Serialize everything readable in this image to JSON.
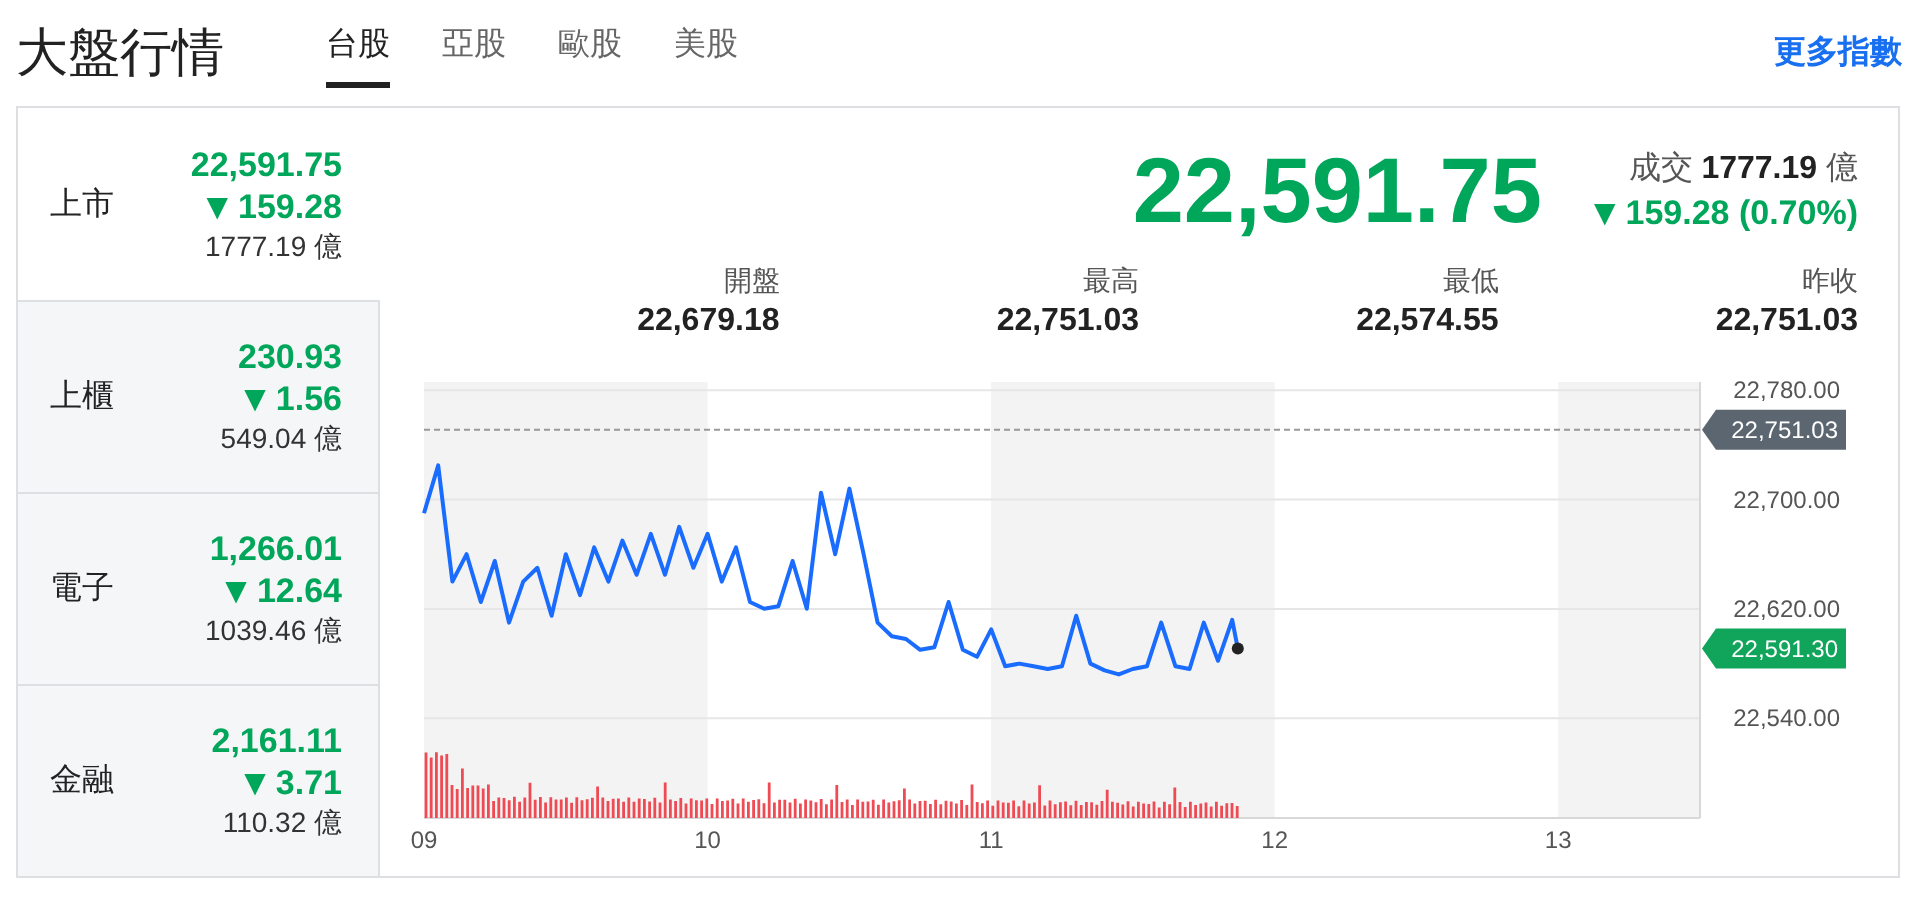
{
  "title": "大盤行情",
  "tabs": [
    {
      "label": "台股",
      "selected": true
    },
    {
      "label": "亞股",
      "selected": false
    },
    {
      "label": "歐股",
      "selected": false
    },
    {
      "label": "美股",
      "selected": false
    }
  ],
  "more_link": "更多指數",
  "indices": [
    {
      "name": "上市",
      "price": "22,591.75",
      "change": "159.28",
      "arrow": "▼",
      "volume": "1777.19",
      "unit": "億",
      "selected": true
    },
    {
      "name": "上櫃",
      "price": "230.93",
      "change": "1.56",
      "arrow": "▼",
      "volume": "549.04",
      "unit": "億",
      "selected": false
    },
    {
      "name": "電子",
      "price": "1,266.01",
      "change": "12.64",
      "arrow": "▼",
      "volume": "1039.46",
      "unit": "億",
      "selected": false
    },
    {
      "name": "金融",
      "price": "2,161.11",
      "change": "3.71",
      "arrow": "▼",
      "volume": "110.32",
      "unit": "億",
      "selected": false
    }
  ],
  "quote": {
    "price": "22,591.75",
    "volume_label": "成交",
    "volume": "1777.19",
    "unit": "億",
    "change": "159.28 (0.70%)",
    "arrow": "▼"
  },
  "stats": [
    {
      "label": "開盤",
      "value": "22,679.18"
    },
    {
      "label": "最高",
      "value": "22,751.03"
    },
    {
      "label": "最低",
      "value": "22,574.55"
    },
    {
      "label": "昨收",
      "value": "22,751.03"
    }
  ],
  "chart_data": {
    "type": "line",
    "x": [
      9.0,
      9.05,
      9.1,
      9.15,
      9.2,
      9.25,
      9.3,
      9.35,
      9.4,
      9.45,
      9.5,
      9.55,
      9.6,
      9.65,
      9.7,
      9.75,
      9.8,
      9.85,
      9.9,
      9.95,
      10.0,
      10.05,
      10.1,
      10.15,
      10.2,
      10.25,
      10.3,
      10.35,
      10.4,
      10.45,
      10.5,
      10.55,
      10.6,
      10.65,
      10.7,
      10.75,
      10.8,
      10.85,
      10.9,
      10.95,
      11.0,
      11.05,
      11.1,
      11.15,
      11.2,
      11.25,
      11.3,
      11.35,
      11.4,
      11.45,
      11.5,
      11.55,
      11.6,
      11.65,
      11.7,
      11.75,
      11.8,
      11.85,
      11.87
    ],
    "series": [
      {
        "color": "#1a6cff",
        "values": [
          22690,
          22725,
          22640,
          22660,
          22625,
          22655,
          22610,
          22640,
          22650,
          22615,
          22660,
          22630,
          22665,
          22640,
          22670,
          22645,
          22675,
          22645,
          22680,
          22650,
          22675,
          22640,
          22665,
          22625,
          22620,
          22622,
          22655,
          22620,
          22705,
          22660,
          22708,
          22660,
          22610,
          22600,
          22598,
          22590,
          22592,
          22625,
          22590,
          22585,
          22605,
          22578,
          22580,
          22578,
          22576,
          22578,
          22615,
          22580,
          22575,
          22572,
          22576,
          22578,
          22610,
          22578,
          22576,
          22610,
          22582,
          22612,
          22591
        ]
      }
    ],
    "xlim": [
      9,
      13.5
    ],
    "ylim": [
      22467,
      22786
    ],
    "grid": true,
    "xticks": [
      {
        "value": 9,
        "label": "09"
      },
      {
        "value": 10,
        "label": "10"
      },
      {
        "value": 11,
        "label": "11"
      },
      {
        "value": 12,
        "label": "12"
      },
      {
        "value": 13,
        "label": "13"
      }
    ],
    "yticks": [
      {
        "value": 22780,
        "label": "22,780.00"
      },
      {
        "value": 22700,
        "label": "22,700.00"
      },
      {
        "value": 22620,
        "label": "22,620.00"
      },
      {
        "value": 22540,
        "label": "22,540.00"
      }
    ],
    "ref_lines": [
      {
        "axis": "y",
        "value": 22751.03,
        "label": "22,751.03"
      }
    ],
    "annotations": [
      "22,591.30"
    ]
  }
}
